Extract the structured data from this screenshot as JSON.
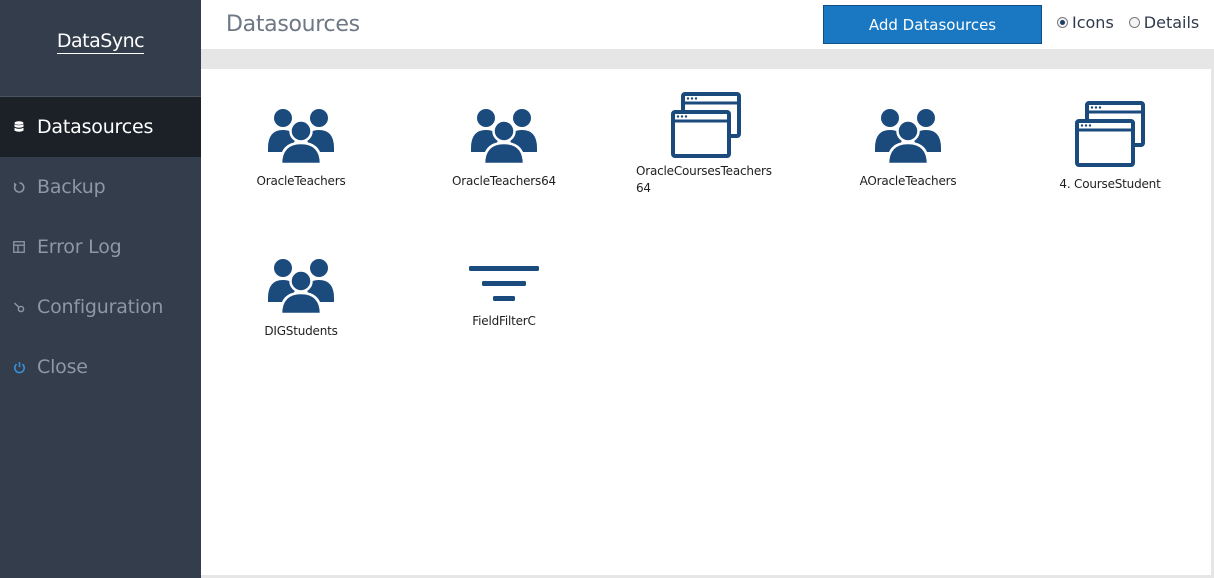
{
  "app": {
    "logo_text": "DataSync"
  },
  "sidebar": {
    "items": [
      {
        "label": "Datasources",
        "icon": "database-icon",
        "active": true
      },
      {
        "label": "Backup",
        "icon": "backup-icon",
        "active": false
      },
      {
        "label": "Error Log",
        "icon": "table-icon",
        "active": false
      },
      {
        "label": "Configuration",
        "icon": "wrench-icon",
        "active": false
      },
      {
        "label": "Close",
        "icon": "power-icon",
        "active": false
      }
    ]
  },
  "header": {
    "title": "Datasources",
    "add_button_label": "Add Datasources",
    "view_options": [
      {
        "label": "Icons",
        "checked": true
      },
      {
        "label": "Details",
        "checked": false
      }
    ]
  },
  "datasources": [
    {
      "name": "OracleTeachers",
      "icon": "users-icon"
    },
    {
      "name": "OracleTeachers64",
      "icon": "users-icon"
    },
    {
      "name": "OracleCoursesTeachers64",
      "icon": "windows-icon"
    },
    {
      "name": "AOracleTeachers",
      "icon": "users-icon"
    },
    {
      "name": "4. CourseStudent",
      "icon": "windows-icon"
    },
    {
      "name": "DIGStudents",
      "icon": "users-icon"
    },
    {
      "name": "FieldFilterC",
      "icon": "filter-icon"
    }
  ],
  "colors": {
    "sidebar_bg": "#333d4b",
    "sidebar_active_bg": "#1c2128",
    "accent_button": "#1a78c2",
    "icon_blue": "#1b4a7d",
    "close_icon": "#3a8fd6"
  }
}
